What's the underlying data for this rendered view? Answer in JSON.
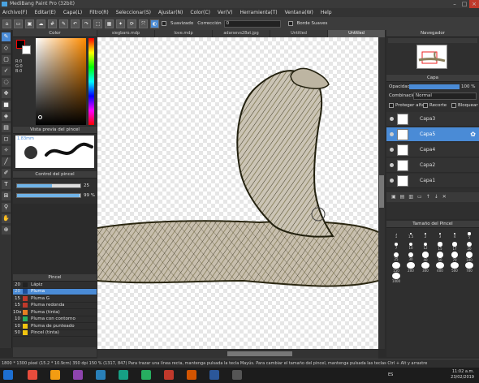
{
  "window": {
    "title": "MediBang Paint Pro (32bit)"
  },
  "menu": [
    "Archivo(F)",
    "Editar(E)",
    "Capa(L)",
    "Filtro(R)",
    "Seleccionar(S)",
    "Ajustar(N)",
    "Color(C)",
    "Ver(V)",
    "Herramienta(T)",
    "Ventana(W)",
    "Help"
  ],
  "toolbar": {
    "suavizado_label": "Suavizado",
    "correccion_label": "Corrección",
    "correccion_value": "0",
    "borde_label": "Borde Suaves"
  },
  "tabs": [
    "siegbaro.mdp",
    "love.mdp",
    "adarsevs28at.jpg",
    "Untitled",
    "Untitled"
  ],
  "color_panel": {
    "title": "Color",
    "r": "R:0",
    "g": "G:0",
    "b": "B:0"
  },
  "preview_panel": {
    "title": "Vista previa del pincel",
    "size": "1.83mm"
  },
  "control_panel": {
    "title": "Control del pincel",
    "size_value": "25",
    "opacity_value": "99 %",
    "size_fraction": 0.55,
    "opacity_fraction": 0.99
  },
  "brush_panel": {
    "title": "Pincel",
    "items": [
      {
        "size": "20",
        "name": "Lápiz",
        "color": "#222222",
        "selected": false
      },
      {
        "size": "20",
        "name": "Pluma",
        "color": "#1d4f9a",
        "selected": true
      },
      {
        "size": "15",
        "name": "Pluma G",
        "color": "#c0392b",
        "selected": false
      },
      {
        "size": "15",
        "name": "Pluma redonda",
        "color": "#c0392b",
        "selected": false
      },
      {
        "size": "10o",
        "name": "Pluma (tinta)",
        "color": "#e67e22",
        "selected": false
      },
      {
        "size": "10",
        "name": "Pluma con contorno",
        "color": "#27ae60",
        "selected": false
      },
      {
        "size": "10",
        "name": "Pluma de punteado",
        "color": "#f1c40f",
        "selected": false
      },
      {
        "size": "50",
        "name": "Pincel (tinta)",
        "color": "#f1c40f",
        "selected": false
      }
    ]
  },
  "navigator": {
    "title": "Navegador"
  },
  "layer_panel": {
    "title": "Capa",
    "opacity_label": "Opacidad",
    "opacity_value": "100 %",
    "blend_label": "Combinación",
    "blend_value": "Normal",
    "protect_label": "Proteger alfa",
    "clip_label": "Recorte",
    "lock_label": "Bloquear",
    "layers": [
      {
        "name": "Capa3",
        "selected": false
      },
      {
        "name": "Capa5",
        "selected": true
      },
      {
        "name": "Capa4",
        "selected": false
      },
      {
        "name": "Capa2",
        "selected": false
      },
      {
        "name": "Capa1",
        "selected": false
      }
    ]
  },
  "size_panel": {
    "title": "Tamaño del Pincel",
    "sizes": [
      "1",
      "1.5",
      "2",
      "3",
      "4",
      "5",
      "7",
      "10",
      "12",
      "15",
      "17",
      "20",
      "25",
      "30",
      "40",
      "50",
      "70",
      "100",
      "150",
      "200",
      "300",
      "400",
      "500",
      "700",
      "1000"
    ]
  },
  "status": {
    "text": "1800 * 1300 píxel  (15.2 * 10.9cm)  350 dpi  150 %  (1317, 847)  Para trazar una línea recta, mantenga pulsada la tecla Mayús. Para cambiar el tamaño del pincel, mantenga pulsada las teclas Ctrl + Alt y arrastre"
  },
  "taskbar": {
    "lang": "ES",
    "time": "11:02 a.m.",
    "date": "23/02/2019"
  }
}
